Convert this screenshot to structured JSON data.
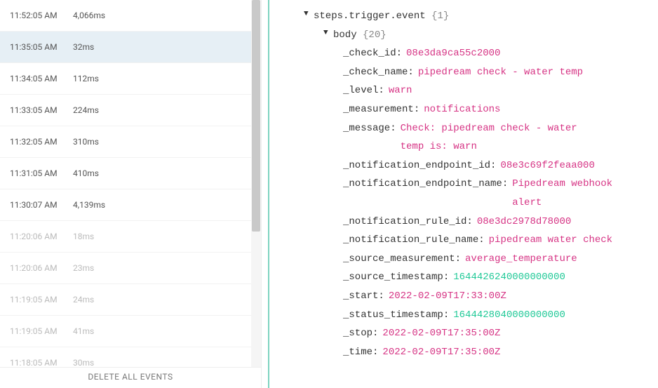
{
  "events": [
    {
      "time": "11:52:05 AM",
      "duration": "4,066ms",
      "state": ""
    },
    {
      "time": "11:35:05 AM",
      "duration": "32ms",
      "state": "selected"
    },
    {
      "time": "11:34:05 AM",
      "duration": "112ms",
      "state": ""
    },
    {
      "time": "11:33:05 AM",
      "duration": "224ms",
      "state": ""
    },
    {
      "time": "11:32:05 AM",
      "duration": "310ms",
      "state": ""
    },
    {
      "time": "11:31:05 AM",
      "duration": "410ms",
      "state": ""
    },
    {
      "time": "11:30:07 AM",
      "duration": "4,139ms",
      "state": ""
    },
    {
      "time": "11:20:06 AM",
      "duration": "18ms",
      "state": "faded"
    },
    {
      "time": "11:20:06 AM",
      "duration": "23ms",
      "state": "faded"
    },
    {
      "time": "11:19:05 AM",
      "duration": "24ms",
      "state": "faded"
    },
    {
      "time": "11:19:05 AM",
      "duration": "41ms",
      "state": "faded"
    },
    {
      "time": "11:18:05 AM",
      "duration": "30ms",
      "state": "faded"
    }
  ],
  "delete_label": "DELETE ALL EVENTS",
  "tree": {
    "root_label": "steps.trigger.event",
    "root_count": "{1}",
    "body_label": "body",
    "body_count": "{20}",
    "fields": {
      "check_id": {
        "k": "_check_id:",
        "v": "08e3da9ca55c2000",
        "c": "red"
      },
      "check_name": {
        "k": "_check_name:",
        "v": "pipedream check - water temp",
        "c": "red"
      },
      "level": {
        "k": "_level:",
        "v": "warn",
        "c": "red"
      },
      "measurement": {
        "k": "_measurement:",
        "v": "notifications",
        "c": "red"
      },
      "message": {
        "k": "_message:",
        "v": "Check: pipedream check - water temp is: warn",
        "c": "red",
        "wrap": true
      },
      "notification_endpoint_id": {
        "k": "_notification_endpoint_id:",
        "v": "08e3c69f2feaa000",
        "c": "red"
      },
      "notification_endpoint_name": {
        "k": "_notification_endpoint_name:",
        "v": "Pipedream webhook alert",
        "c": "red",
        "wrap": true
      },
      "notification_rule_id": {
        "k": "_notification_rule_id:",
        "v": "08e3dc2978d78000",
        "c": "red"
      },
      "notification_rule_name": {
        "k": "_notification_rule_name:",
        "v": "pipedream water check",
        "c": "red",
        "wrap": true
      },
      "source_measurement": {
        "k": "_source_measurement:",
        "v": "average_temperature",
        "c": "red"
      },
      "source_timestamp": {
        "k": "_source_timestamp:",
        "v": "1644426240000000000",
        "c": "green"
      },
      "start": {
        "k": "_start:",
        "v": "2022-02-09T17:33:00Z",
        "c": "red"
      },
      "status_timestamp": {
        "k": "_status_timestamp:",
        "v": "1644428040000000000",
        "c": "green"
      },
      "stop": {
        "k": "_stop:",
        "v": "2022-02-09T17:35:00Z",
        "c": "red"
      },
      "time": {
        "k": "_time:",
        "v": "2022-02-09T17:35:00Z",
        "c": "red"
      }
    }
  }
}
